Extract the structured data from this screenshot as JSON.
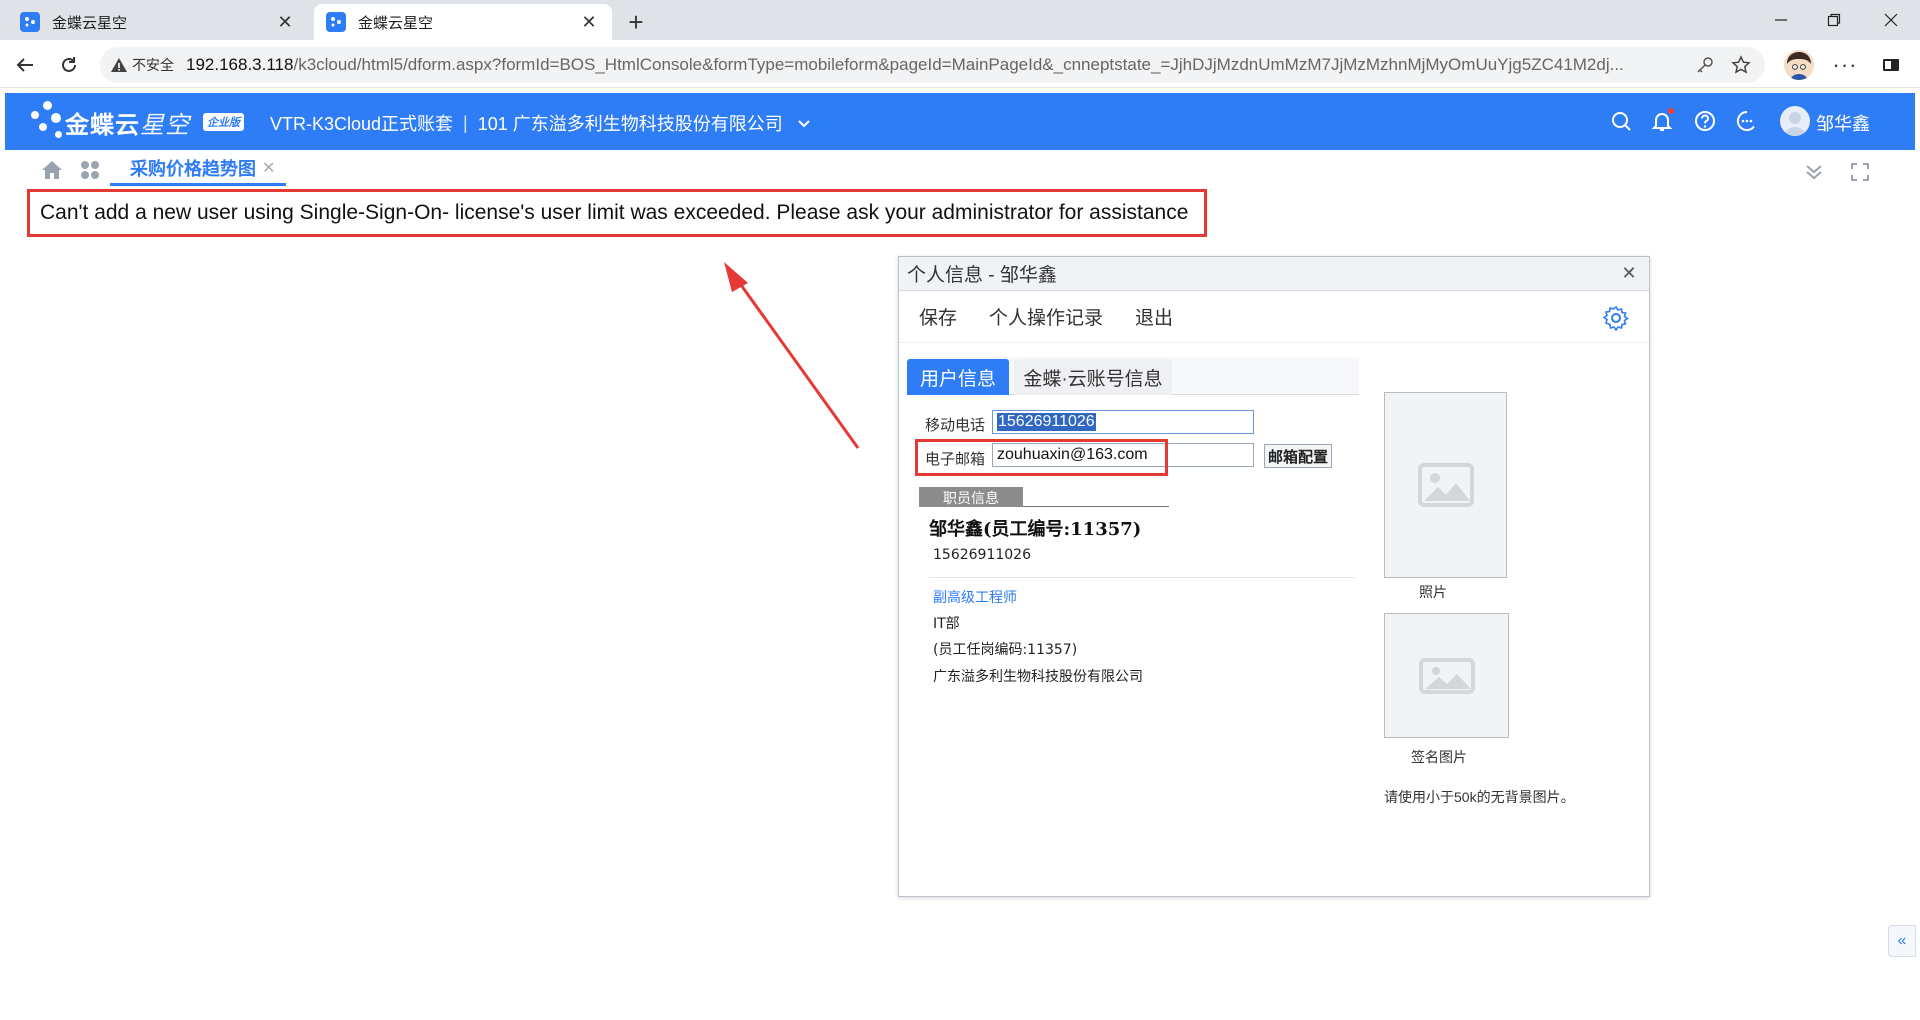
{
  "browser": {
    "tabs": [
      {
        "title": "金蝶云星空",
        "active": false
      },
      {
        "title": "金蝶云星空",
        "active": true
      }
    ],
    "insecure_label": "不安全",
    "url_host": "192.168.3.118",
    "url_rest": "/k3cloud/html5/dform.aspx?formId=BOS_HtmlConsole&formType=mobileform&pageId=MainPageId&_cnneptstate_=JjhDJjMzdnUmMzM7JjMzMzhnMjMyOmUuYjg5ZC41M2dj..."
  },
  "app": {
    "logo_bold": "金蝶云",
    "logo_light": "星空",
    "edition": "企业版",
    "account": "VTR-K3Cloud正式账套",
    "company": "101 广东溢多利生物科技股份有限公司",
    "user_name": "邹华鑫",
    "accent_color": "#2e7cf6"
  },
  "page_tabs": [
    {
      "label": "采购价格趋势图",
      "active": true
    }
  ],
  "message": "Can't add a new user using Single-Sign-On- license's user limit was exceeded. Please ask your administrator for assistance",
  "dialog": {
    "title": "个人信息 - 邹华鑫",
    "toolbar": [
      "保存",
      "个人操作记录",
      "退出"
    ],
    "tabs": [
      "用户信息",
      "金蝶·云账号信息"
    ],
    "fields": {
      "mobile_label": "移动电话",
      "mobile_value": "15626911026",
      "email_label": "电子邮箱",
      "email_value": "zouhuaxin@163.com",
      "email_button": "邮箱配置"
    },
    "employee": {
      "section_label": "职员信息",
      "name_line": "邹华鑫(员工编号:11357)",
      "phone": "15626911026",
      "title": "副高级工程师",
      "department": "IT部",
      "post_code": "(员工任岗编码:11357)",
      "company": "广东溢多利生物科技股份有限公司"
    },
    "photo_caption": "照片",
    "signature_caption": "签名图片",
    "hint": "请使用小于50k的无背景图片。"
  }
}
